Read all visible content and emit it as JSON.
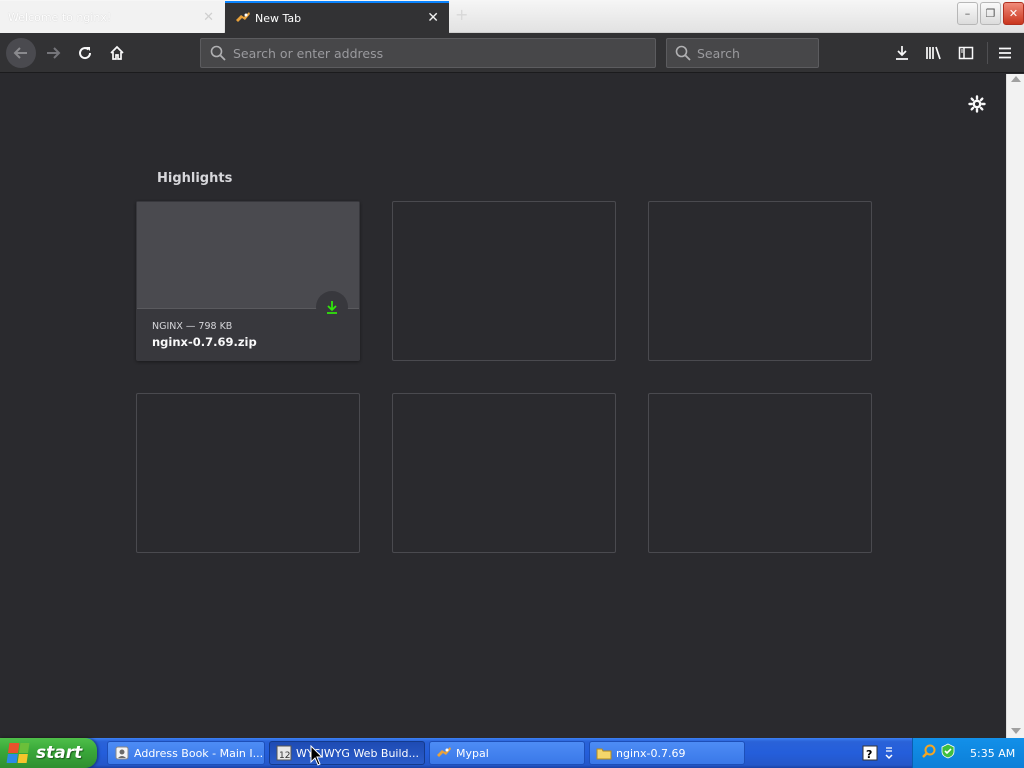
{
  "tabs": [
    {
      "label": "Welcome to nginx!",
      "active": false
    },
    {
      "label": "New Tab",
      "active": true
    }
  ],
  "window_controls": {
    "minimize": "–",
    "restore": "❐",
    "close": "✕"
  },
  "toolbar": {
    "url_placeholder": "Search or enter address",
    "search_placeholder": "Search"
  },
  "content": {
    "section_title": "Highlights",
    "cards": [
      {
        "context": "NGINX — 798 KB",
        "title": "nginx-0.7.69.zip",
        "icon": "download-icon"
      }
    ]
  },
  "taskbar": {
    "start_label": "start",
    "tasks": [
      {
        "label": "Address Book - Main I...",
        "icon": "address-book-icon"
      },
      {
        "label": "WYSIWYG Web Build...",
        "icon": "web-builder-icon",
        "active": true
      },
      {
        "label": "Mypal",
        "icon": "mypal-icon"
      },
      {
        "label": "nginx-0.7.69",
        "icon": "folder-icon"
      }
    ],
    "clock": "5:35 AM"
  },
  "colors": {
    "accent": "#0a84ff",
    "download_green": "#30e60b",
    "content_bg": "#2a2a2e",
    "toolbar_bg": "#323234"
  }
}
